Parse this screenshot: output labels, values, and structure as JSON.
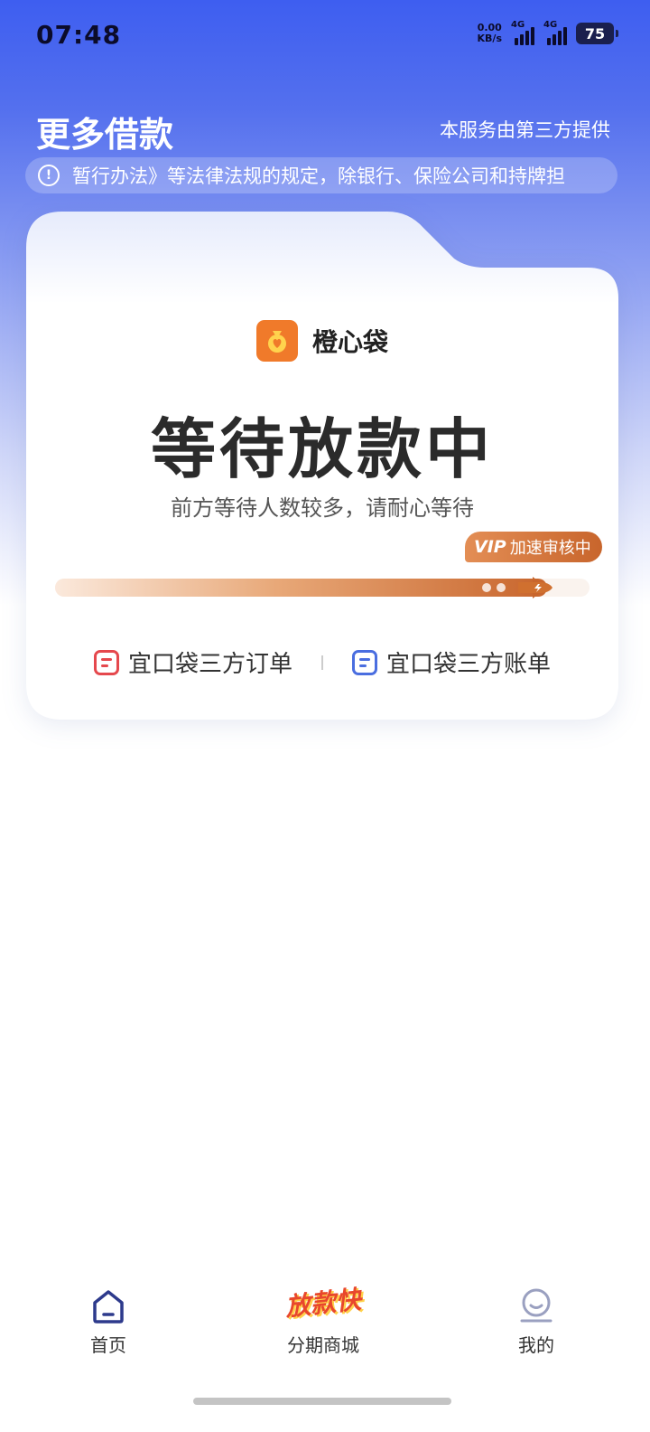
{
  "status_bar": {
    "time": "07:48",
    "net_speed_value": "0.00",
    "net_speed_unit": "KB/s",
    "signal1_label": "4G",
    "signal2_label": "4G",
    "battery": "75"
  },
  "header": {
    "title": "更多借款",
    "provider_note": "本服务由第三方提供"
  },
  "notice": {
    "icon": "info-icon",
    "text": "暂行办法》等法律法规的规定，除银行、保险公司和持牌担"
  },
  "card": {
    "brand_icon": "money-bag-heart-icon",
    "brand_name": "橙心袋",
    "status_title": "等待放款中",
    "status_subtitle": "前方等待人数较多，请耐心等待",
    "vip_mark": "VIP",
    "vip_text": "加速审核中",
    "progress": 0.92,
    "links": [
      {
        "label": "宜口袋三方订单",
        "icon": "order-doc-icon",
        "color": "#e5484d"
      },
      {
        "label": "宜口袋三方账单",
        "icon": "bill-doc-icon",
        "color": "#4a6ee0"
      }
    ]
  },
  "bottom_nav": {
    "items": [
      {
        "label": "首页",
        "icon": "home-icon"
      },
      {
        "label": "分期商城",
        "icon": "promo-badge",
        "badge_text": "放款快"
      },
      {
        "label": "我的",
        "icon": "profile-icon"
      }
    ]
  },
  "colors": {
    "brand_blue": "#3e5ef0",
    "accent_orange": "#c8652c",
    "brand_logo": "#f07a2a"
  }
}
